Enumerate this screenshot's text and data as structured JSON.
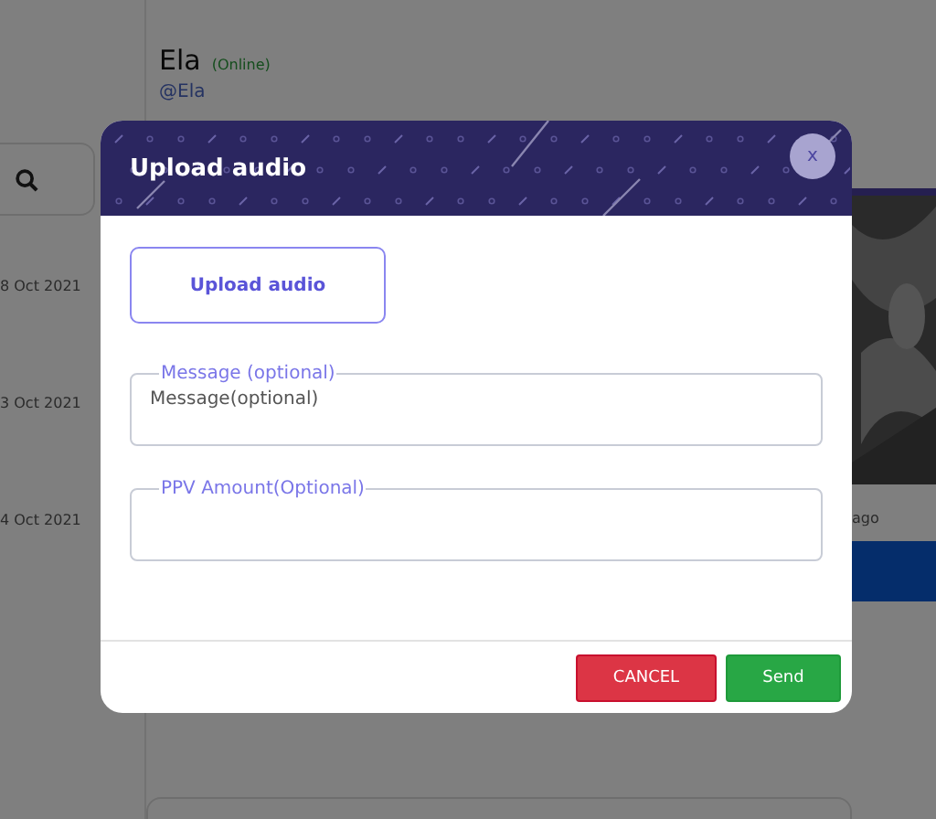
{
  "profile": {
    "name": "Ela",
    "status": "(Online)",
    "handle": "@Ela"
  },
  "conversations": [
    {
      "date": "8 Oct 2021"
    },
    {
      "date": "3 Oct 2021"
    },
    {
      "date": "4 Oct 2021"
    }
  ],
  "media_panel": {
    "kind": "picture",
    "time": "ago"
  },
  "dialog": {
    "title": "Upload audio",
    "close": "x",
    "upload_button": "Upload audio",
    "fields": [
      {
        "legend": "Message (optional)",
        "value": "Message(optional)"
      },
      {
        "legend": "PPV Amount(Optional)"
      }
    ],
    "buttons": [
      {
        "label": "CANCEL",
        "kind": "danger"
      },
      {
        "label": "Send",
        "kind": "success"
      }
    ]
  }
}
